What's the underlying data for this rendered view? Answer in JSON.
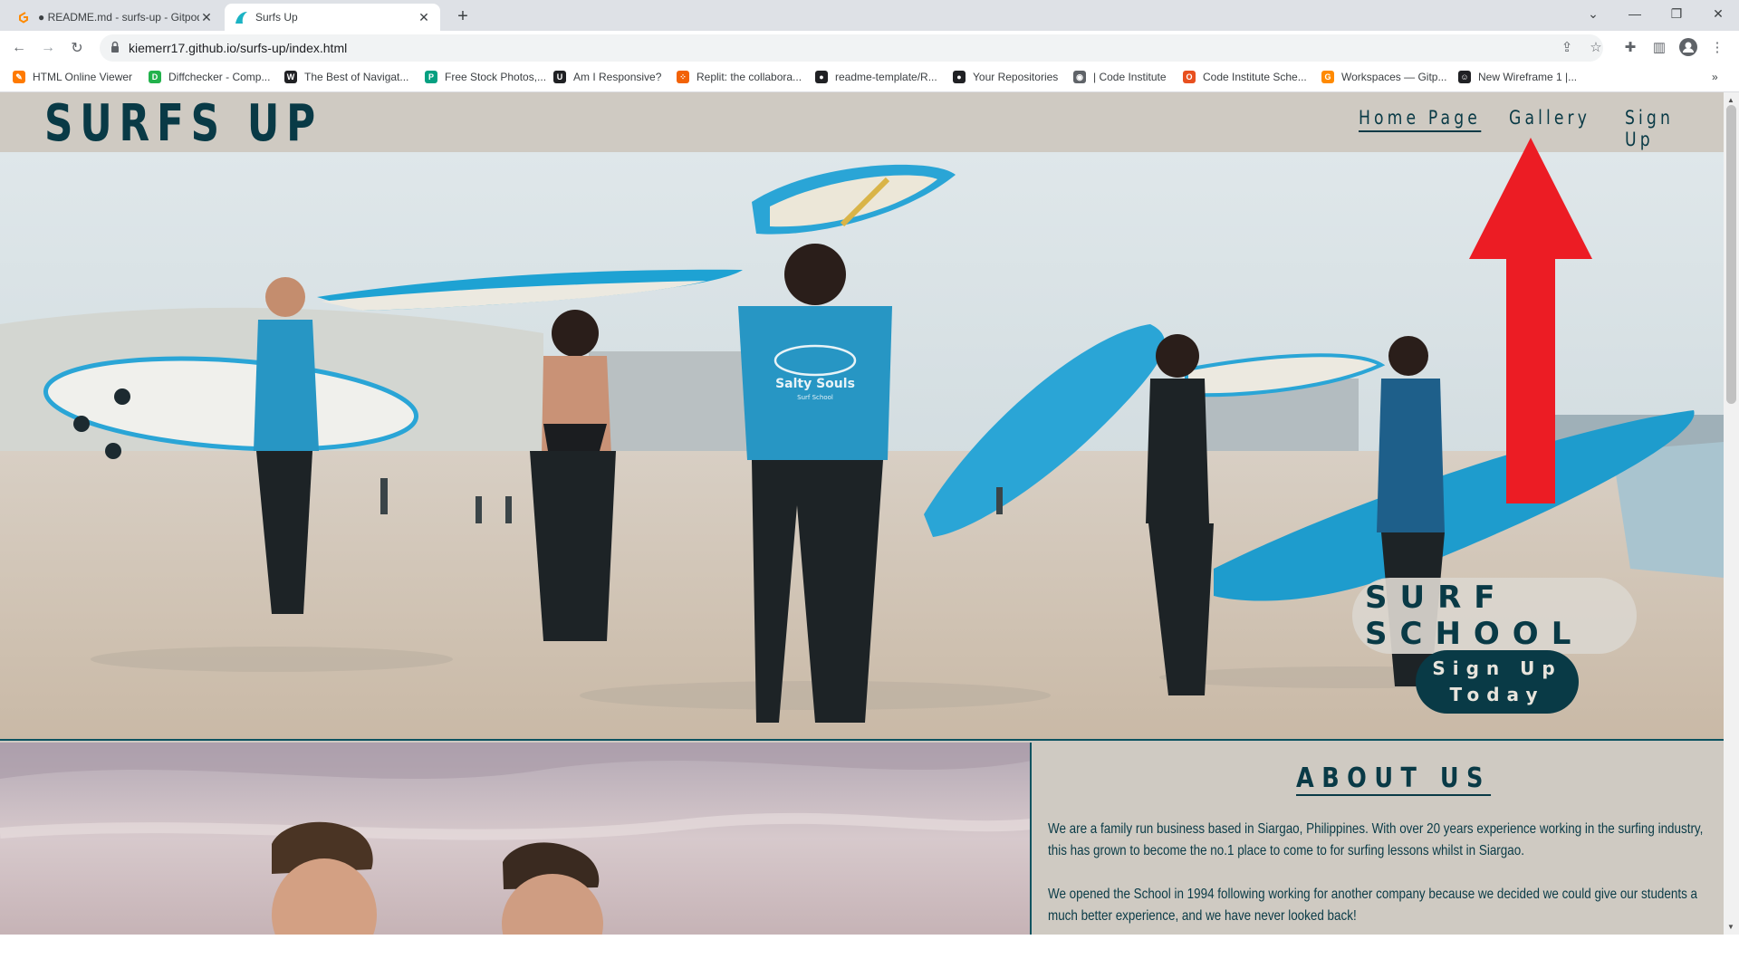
{
  "browser": {
    "tabs": [
      {
        "title": "● README.md - surfs-up - Gitpod",
        "icon": "gitpod-icon",
        "active": false
      },
      {
        "title": "Surfs Up",
        "icon": "surf-wave-icon",
        "active": true
      }
    ],
    "address": "kiemerr17.github.io/surfs-up/index.html",
    "bookmarks": [
      {
        "label": "HTML Online Viewer",
        "icon": "pen-icon",
        "color": "#ff7a00"
      },
      {
        "label": "Diffchecker - Comp...",
        "icon": "diffchecker-icon",
        "color": "#22b24c"
      },
      {
        "label": "The Best of Navigat...",
        "icon": "w-icon",
        "color": "#202124"
      },
      {
        "label": "Free Stock Photos,...",
        "icon": "pexels-icon",
        "color": "#05a081"
      },
      {
        "label": "Am I Responsive?",
        "icon": "responsive-icon",
        "color": "#202124"
      },
      {
        "label": "Replit: the collabora...",
        "icon": "replit-icon",
        "color": "#f26207"
      },
      {
        "label": "readme-template/R...",
        "icon": "github-icon",
        "color": "#202124"
      },
      {
        "label": "Your Repositories",
        "icon": "github-icon",
        "color": "#202124"
      },
      {
        "label": "| Code Institute",
        "icon": "globe-icon",
        "color": "#5f6368"
      },
      {
        "label": "Code Institute Sche...",
        "icon": "code-institute-icon",
        "color": "#e8501f"
      },
      {
        "label": "Workspaces — Gitp...",
        "icon": "gitpod-icon",
        "color": "#ff8a00"
      },
      {
        "label": "New Wireframe 1 |...",
        "icon": "wireframe-icon",
        "color": "#202124"
      }
    ]
  },
  "site": {
    "logo": "SURFS UP",
    "nav": [
      {
        "label": "Home Page",
        "active": true
      },
      {
        "label": "Gallery",
        "active": false
      },
      {
        "label": "Sign Up",
        "active": false
      }
    ],
    "hero": {
      "heading": "SURF SCHOOL",
      "button": "Sign Up\nToday",
      "shirt_text": "Salty Souls",
      "shirt_subtext": "Surf School"
    },
    "about": {
      "title": "ABOUT US",
      "paragraphs": [
        "We are a family run business based in Siargao, Philippines. With over 20 years experience working in the surfing industry, this has grown to become the no.1 place to come to for surfing lessons whilst in Siargao.",
        "We opened the School in 1994 following working for another company because we decided we could give our students a much better experience, and we have never looked back!"
      ]
    }
  },
  "colors": {
    "brand_dark": "#093a46",
    "header_bg": "#cfcac2",
    "annotation_arrow": "#ec1c24",
    "board_blue": "#2aa5d6"
  }
}
